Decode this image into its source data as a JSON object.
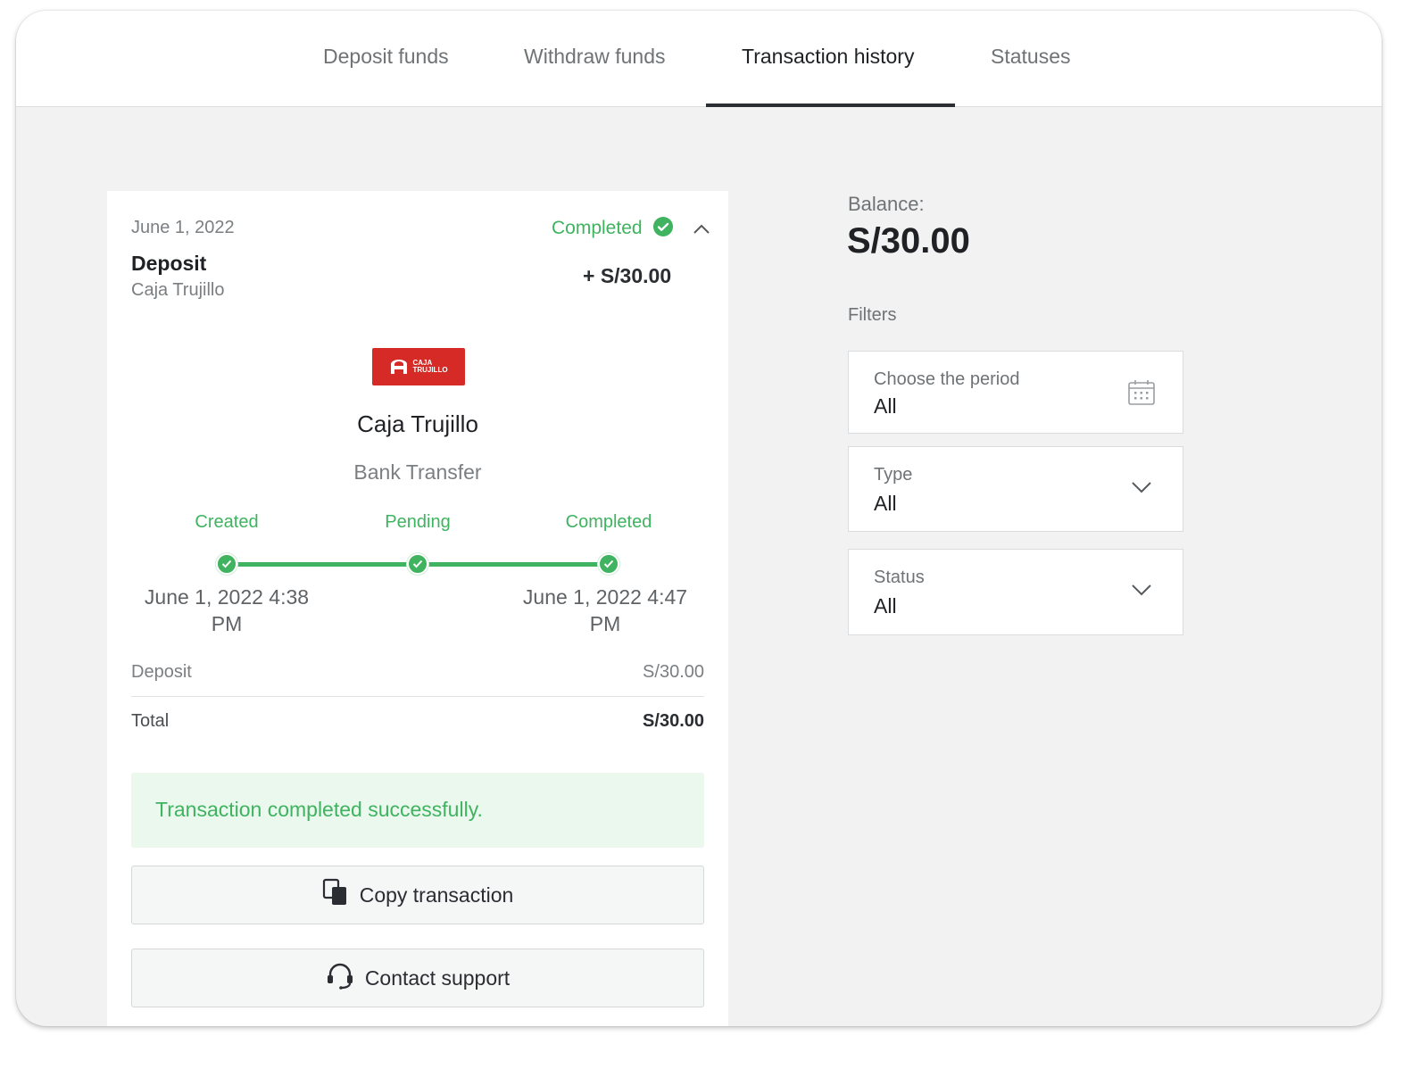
{
  "tabs": [
    {
      "label": "Deposit funds",
      "active": false
    },
    {
      "label": "Withdraw funds",
      "active": false
    },
    {
      "label": "Transaction history",
      "active": true
    },
    {
      "label": "Statuses",
      "active": false
    }
  ],
  "transaction": {
    "date": "June 1, 2022",
    "status": "Completed",
    "type": "Deposit",
    "provider_small": "Caja Trujillo",
    "amount": "+ S/30.00",
    "logo_text_line1": "CAJA",
    "logo_text_line2": "TRUJILLO",
    "provider_name": "Caja Trujillo",
    "method": "Bank Transfer",
    "steps": [
      {
        "label": "Created",
        "time_line1": "June 1, 2022 4:38",
        "time_line2": "PM"
      },
      {
        "label": "Pending",
        "time_line1": "",
        "time_line2": ""
      },
      {
        "label": "Completed",
        "time_line1": "June 1, 2022 4:47",
        "time_line2": "PM"
      }
    ],
    "rows": [
      {
        "label": "Deposit",
        "value": "S/30.00"
      },
      {
        "label": "Total",
        "value": "S/30.00"
      }
    ],
    "success_message": "Transaction completed successfully.",
    "copy_button": "Copy transaction",
    "support_button": "Contact support"
  },
  "sidebar": {
    "balance_label": "Balance:",
    "balance_value": "S/30.00",
    "filters_label": "Filters",
    "filters": [
      {
        "label": "Choose the period",
        "value": "All",
        "icon": "calendar-icon"
      },
      {
        "label": "Type",
        "value": "All",
        "icon": "chevron-down-icon"
      },
      {
        "label": "Status",
        "value": "All",
        "icon": "chevron-down-icon"
      }
    ]
  },
  "colors": {
    "accent_green": "#3fb35f",
    "logo_red": "#d62a26",
    "success_bg": "#ebf8ee"
  }
}
